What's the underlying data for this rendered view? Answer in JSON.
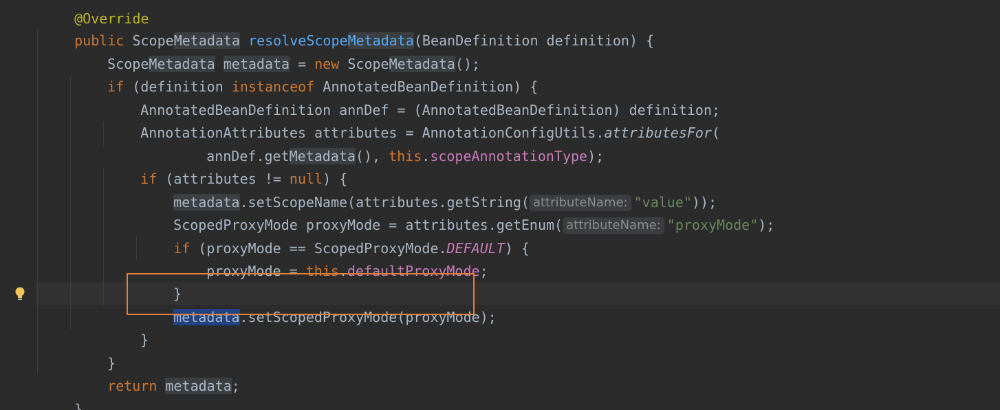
{
  "editor": {
    "annotation_partial": "@Override",
    "lines": {
      "sig_public": "public",
      "sig_type_a": "Scope",
      "sig_type_b": "Metadata",
      "sig_fn_a": "resolveScope",
      "sig_fn_b": "Metadata",
      "sig_rest": "(BeanDefinition definition) {",
      "l2_type_a": "Scope",
      "l2_type_b": "Metadata",
      "l2_var": "metadata",
      "l2_eq": " = ",
      "l2_new": "new",
      "l2_ctor_a": " Scope",
      "l2_ctor_b": "Metadata",
      "l2_end": "();",
      "l3_if": "if",
      "l3_mid": " (definition ",
      "l3_instanceof": "instanceof",
      "l3_end": " AnnotatedBeanDefinition) {",
      "l4": "AnnotatedBeanDefinition annDef = (AnnotatedBeanDefinition) definition;",
      "l5_a": "AnnotationAttributes attributes = AnnotationConfigUtils.",
      "l5_call": "attributesFor",
      "l5_end": "(",
      "l6_a": "annDef.get",
      "l6_b": "Metadata",
      "l6_c": "(), ",
      "l6_this": "this",
      "l6_dot": ".",
      "l6_field": "scopeAnnotationType",
      "l6_end": ");",
      "l7_if": "if",
      "l7_mid": " (attributes != ",
      "l7_null": "null",
      "l7_end": ") {",
      "l8_var": "metadata",
      "l8_mid": ".setScopeName(attributes.getString(",
      "l8_hint": "attributeName:",
      "l8_str": "\"value\"",
      "l8_end": "));",
      "l9_a": "ScopedProxyMode proxyMode = attributes.getEnum(",
      "l9_hint": "attributeName:",
      "l9_str": "\"proxyMode\"",
      "l9_end": ");",
      "l10_if": "if",
      "l10_mid": " (proxyMode == ScopedProxyMode.",
      "l10_const": "DEFAULT",
      "l10_end": ") {",
      "l11_a": "proxyMode = ",
      "l11_this": "this",
      "l11_dot": ".",
      "l11_field": "defaultProxyMode",
      "l11_end": ";",
      "l12": "}",
      "l13_var": "metadata",
      "l13_end": ".setScopedProxyMode(proxyMode);",
      "l14": "}",
      "l15": "}",
      "l16_return": "return",
      "l16_var": "metadata",
      "l16_end": ";",
      "l17": "}"
    },
    "colors": {
      "background": "#2b2b2b",
      "keyword": "#cc7832",
      "method": "#56a8f5",
      "field": "#c77dbb",
      "string": "#6a8759",
      "default_text": "#a9b7c6",
      "selection": "#214283",
      "highlight_box": "#e3803c"
    },
    "icons": {
      "gutter": "lightbulb-icon"
    }
  }
}
